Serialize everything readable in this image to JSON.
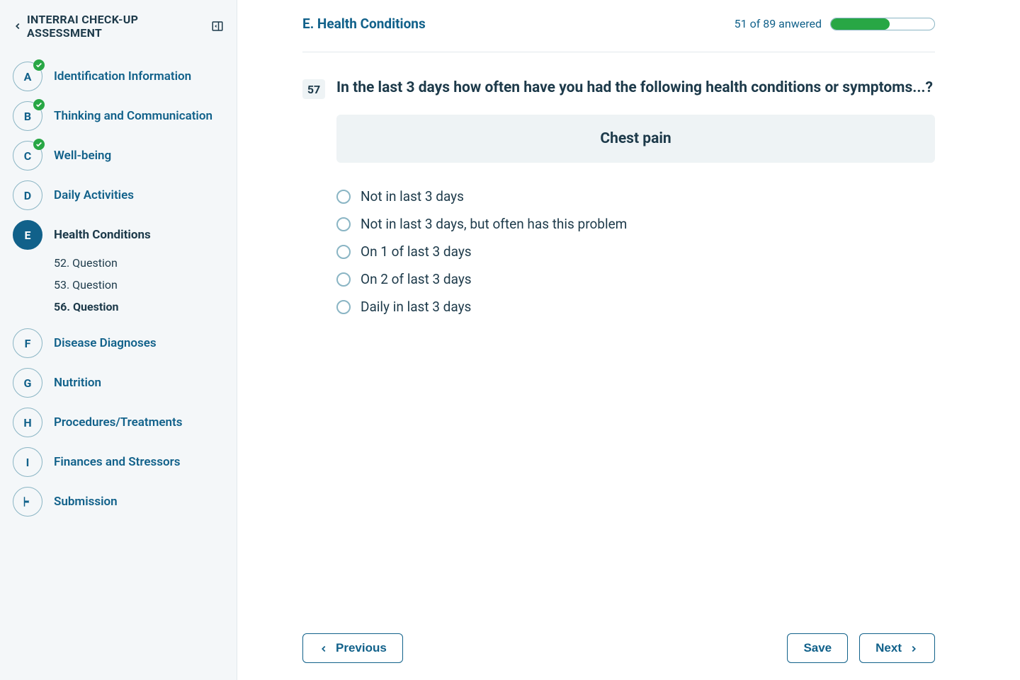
{
  "sidebar": {
    "title": "INTERRAI CHECK-UP ASSESSMENT",
    "sections": [
      {
        "letter": "A",
        "label": "Identification Information",
        "completed": true,
        "active": false,
        "isFlag": false
      },
      {
        "letter": "B",
        "label": "Thinking and Communication",
        "completed": true,
        "active": false,
        "isFlag": false
      },
      {
        "letter": "C",
        "label": "Well-being",
        "completed": true,
        "active": false,
        "isFlag": false
      },
      {
        "letter": "D",
        "label": "Daily Activities",
        "completed": false,
        "active": false,
        "isFlag": false
      },
      {
        "letter": "E",
        "label": "Health Conditions",
        "completed": false,
        "active": true,
        "isFlag": false
      },
      {
        "letter": "F",
        "label": "Disease Diagnoses",
        "completed": false,
        "active": false,
        "isFlag": false
      },
      {
        "letter": "G",
        "label": "Nutrition",
        "completed": false,
        "active": false,
        "isFlag": false
      },
      {
        "letter": "H",
        "label": "Procedures/Treatments",
        "completed": false,
        "active": false,
        "isFlag": false
      },
      {
        "letter": "I",
        "label": "Finances and Stressors",
        "completed": false,
        "active": false,
        "isFlag": false
      },
      {
        "letter": "",
        "label": "Submission",
        "completed": false,
        "active": false,
        "isFlag": true
      }
    ],
    "sub_questions": [
      {
        "label": "52. Question",
        "bold": false
      },
      {
        "label": "53. Question",
        "bold": false
      },
      {
        "label": "56. Question",
        "bold": true
      }
    ]
  },
  "header": {
    "section_title": "E. Health Conditions",
    "progress_text": "51 of 89 anwered",
    "progress_percent": 57
  },
  "question": {
    "number": "57",
    "text": "In the last 3 days how often have you had the following health conditions or symptoms...?",
    "banner": "Chest pain",
    "options": [
      "Not in last 3 days",
      "Not in last 3 days, but often has this problem",
      "On 1 of last 3 days",
      "On 2 of last 3 days",
      "Daily in last 3 days"
    ]
  },
  "footer": {
    "previous": "Previous",
    "save": "Save",
    "next": "Next"
  }
}
